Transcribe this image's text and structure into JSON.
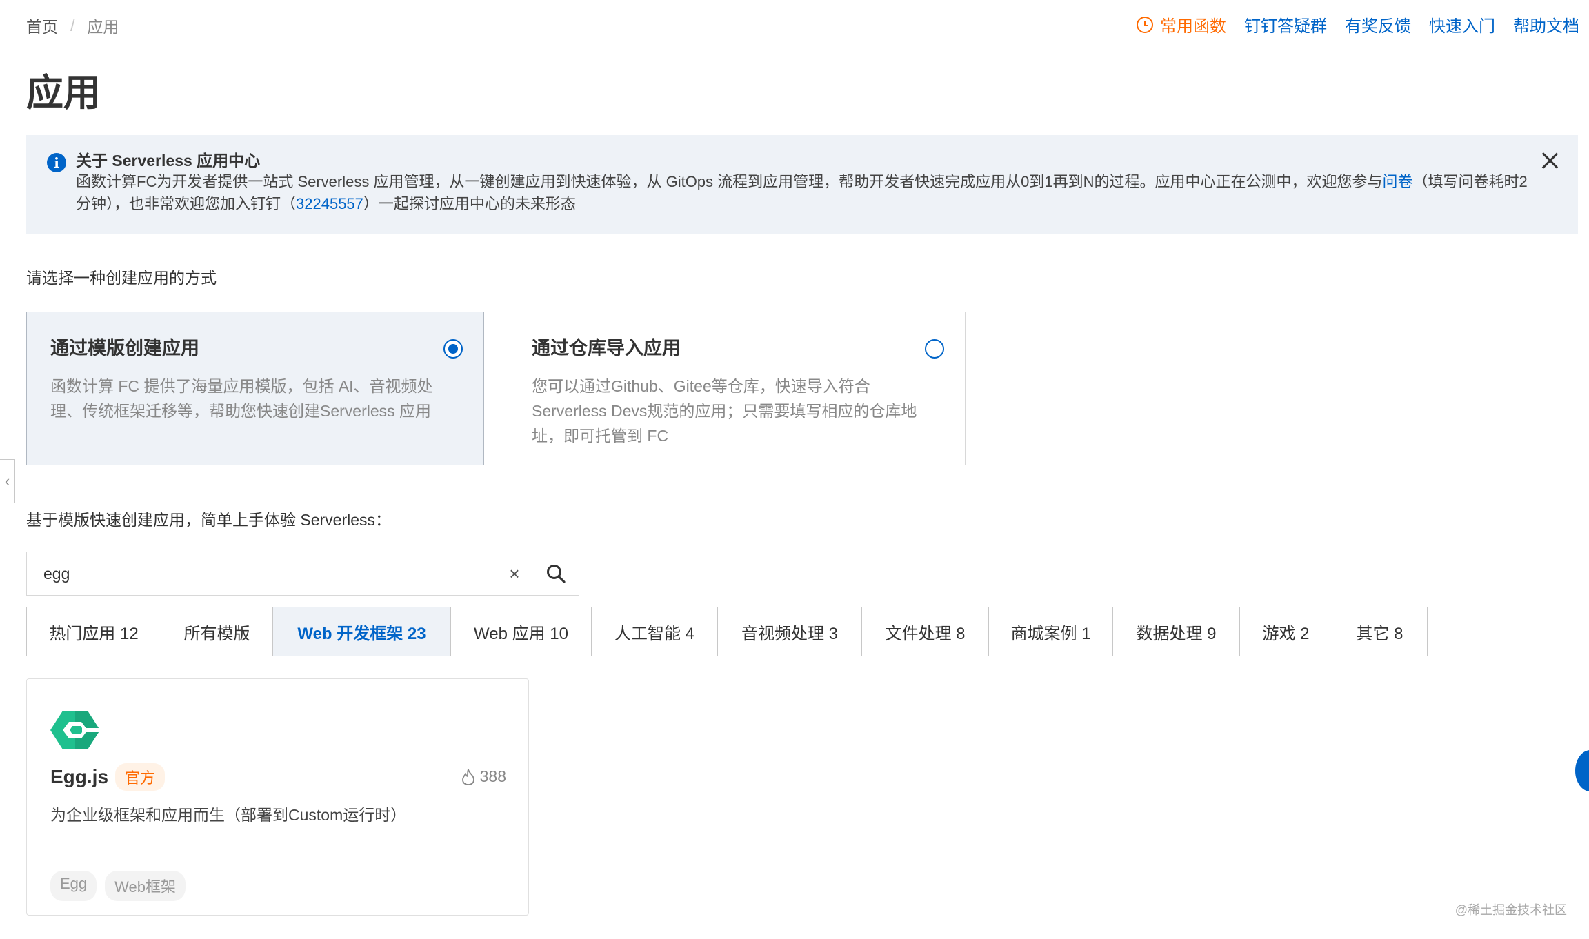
{
  "breadcrumb": {
    "home": "首页",
    "separator": "/",
    "current": "应用"
  },
  "top_links": {
    "common_functions": "常用函数",
    "dingtalk_group": "钉钉答疑群",
    "feedback": "有奖反馈",
    "quick_start": "快速入门",
    "help_docs": "帮助文档"
  },
  "page_title": "应用",
  "banner": {
    "title": "关于 Serverless 应用中心",
    "text_part1": "函数计算FC为开发者提供一站式 Serverless 应用管理，从一键创建应用到快速体验，从 GitOps 流程到应用管理，帮助开发者快速完成应用从0到1再到N的过程。应用中心正在公测中，欢迎您参与",
    "survey_link": "问卷",
    "text_part2": "（填写问卷耗时2分钟），也非常欢迎您加入钉钉（",
    "dingtalk_number": "32245557",
    "text_part3": "）一起探讨应用中心的未来形态"
  },
  "create_method_label": "请选择一种创建应用的方式",
  "choices": [
    {
      "title": "通过模版创建应用",
      "desc": "函数计算 FC 提供了海量应用模版，包括 AI、音视频处理、传统框架迁移等，帮助您快速创建Serverless 应用",
      "selected": true
    },
    {
      "title": "通过仓库导入应用",
      "desc": "您可以通过Github、Gitee等仓库，快速导入符合 Serverless Devs规范的应用；只需要填写相应的仓库地址，即可托管到 FC",
      "selected": false
    }
  ],
  "template_label": "基于模版快速创建应用，简单上手体验 Serverless：",
  "search": {
    "value": "egg",
    "placeholder": ""
  },
  "tabs": [
    {
      "label": "热门应用 12",
      "active": false
    },
    {
      "label": "所有模版",
      "active": false
    },
    {
      "label": "Web 开发框架 23",
      "active": true
    },
    {
      "label": "Web 应用 10",
      "active": false
    },
    {
      "label": "人工智能 4",
      "active": false
    },
    {
      "label": "音视频处理 3",
      "active": false
    },
    {
      "label": "文件处理 8",
      "active": false
    },
    {
      "label": "商城案例 1",
      "active": false
    },
    {
      "label": "数据处理 9",
      "active": false
    },
    {
      "label": "游戏 2",
      "active": false
    },
    {
      "label": "其它 8",
      "active": false
    }
  ],
  "app_card": {
    "name": "Egg.js",
    "badge": "官方",
    "hot_count": "388",
    "desc": "为企业级框架和应用而生（部署到Custom运行时）",
    "tags": [
      "Egg",
      "Web框架"
    ]
  },
  "watermark": "@稀土掘金技术社区",
  "colors": {
    "primary": "#0064c8",
    "accent_orange": "#ff6a00",
    "banner_bg": "#eef2f7",
    "egg_green": "#1fc08e"
  }
}
